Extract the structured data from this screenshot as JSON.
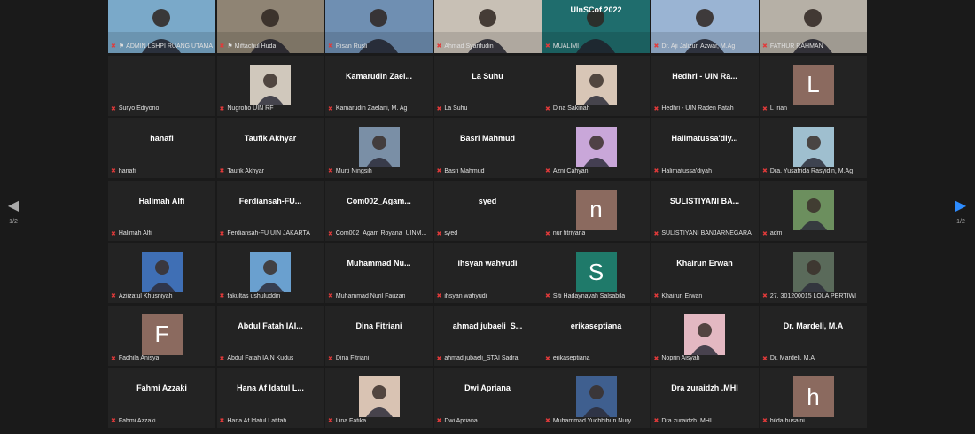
{
  "pager": {
    "indicator": "1/2"
  },
  "colors": {
    "video_bg": "#232323",
    "muted_mic": "#e23a3a",
    "active_border": "#e8d44d",
    "next_arrow": "#2d8cff"
  },
  "participants": [
    {
      "label": "ADMIN LSHPI RUANG UTAMA",
      "kind": "video",
      "bg": "#7aa9c9",
      "pinned": true,
      "active": true
    },
    {
      "label": "Miftachul Huda",
      "kind": "video",
      "bg": "#8f8474",
      "pinned": true
    },
    {
      "label": "Risan Rusli",
      "kind": "video",
      "bg": "#6f8fb2"
    },
    {
      "label": "Ahmad Syarifudin",
      "kind": "video",
      "bg": "#c8c0b5"
    },
    {
      "label": "MUALIMI",
      "kind": "video",
      "bg": "#1f6d6d",
      "banner": "UInSCof 2022"
    },
    {
      "label": "Dr. Aji Jalizun Azwar, M.Ag",
      "kind": "video",
      "bg": "#9ab4d3"
    },
    {
      "label": "FATHUR RAHMAN",
      "kind": "video",
      "bg": "#b6b0a6"
    },
    {
      "label": "Suryo Ediyono",
      "kind": "blank"
    },
    {
      "label": "Nugroho UIN RF",
      "kind": "photo",
      "bg": "#d0c8bc"
    },
    {
      "label": "Kamarudin Zaelani, M. Ag",
      "kind": "name",
      "name": "Kamarudin Zael..."
    },
    {
      "label": "La Suhu",
      "kind": "name",
      "name": "La Suhu"
    },
    {
      "label": "Dina Sakinah",
      "kind": "photo",
      "bg": "#d8c6b6"
    },
    {
      "label": "Hedhri - UIN Raden Fatah",
      "kind": "name",
      "name": "Hedhri - UIN Ra..."
    },
    {
      "label": "L Irian",
      "kind": "letter",
      "letter": "L",
      "color": "#8b6a5f"
    },
    {
      "label": "hanafi",
      "kind": "name",
      "name": "hanafi"
    },
    {
      "label": "Taufik Akhyar",
      "kind": "name",
      "name": "Taufik Akhyar"
    },
    {
      "label": "Murti Ningsih",
      "kind": "photo",
      "bg": "#7a8fa6"
    },
    {
      "label": "Basri Mahmud",
      "kind": "name",
      "name": "Basri Mahmud"
    },
    {
      "label": "Azni Cahyani",
      "kind": "photo",
      "bg": "#c9a7d9"
    },
    {
      "label": "Halimatussa'diyah",
      "kind": "name",
      "name": "Halimatussa'diy..."
    },
    {
      "label": "Dra. Yusafrida Rasyidin, M.Ag",
      "kind": "photo",
      "bg": "#9fbfcf"
    },
    {
      "label": "Halimah Alfi",
      "kind": "name",
      "name": "Halimah Alfi"
    },
    {
      "label": "Ferdiansah-FU UIN JAKARTA",
      "kind": "name",
      "name": "Ferdiansah-FU..."
    },
    {
      "label": "Com002_Agam Royana_UINM...",
      "kind": "name",
      "name": "Com002_Agam..."
    },
    {
      "label": "syed",
      "kind": "name",
      "name": "syed"
    },
    {
      "label": "nur fitriyana",
      "kind": "letter",
      "letter": "n",
      "color": "#8b6a5f"
    },
    {
      "label": "SULISTIYANI BANJARNEGARA",
      "kind": "name",
      "name": "SULISTIYANI BA..."
    },
    {
      "label": "adm",
      "kind": "photo",
      "bg": "#6c8f5e"
    },
    {
      "label": "Aziizatul Khusniyah",
      "kind": "photo",
      "bg": "#3f6fb5"
    },
    {
      "label": "fakultas ushuluddin",
      "kind": "photo",
      "bg": "#6aa0cf"
    },
    {
      "label": "Muhammad Nuril Fauzan",
      "kind": "name",
      "name": "Muhammad Nu..."
    },
    {
      "label": "ihsyan wahyudi",
      "kind": "name",
      "name": "ihsyan wahyudi"
    },
    {
      "label": "Siti Hadaynayah Salsabila",
      "kind": "letter",
      "letter": "S",
      "color": "#1f7a6a"
    },
    {
      "label": "Khairun Erwan",
      "kind": "name",
      "name": "Khairun Erwan"
    },
    {
      "label": "27. 301200015 LOLA PERTIWI",
      "kind": "photo",
      "bg": "#5a6a5a"
    },
    {
      "label": "Fadhila Anisya",
      "kind": "letter",
      "letter": "F",
      "color": "#8b6a5f"
    },
    {
      "label": "Abdul Fatah IAIN Kudus",
      "kind": "name",
      "name": "Abdul Fatah IAI..."
    },
    {
      "label": "Dina Fitriani",
      "kind": "name",
      "name": "Dina Fitriani"
    },
    {
      "label": "ahmad jubaeli_STAI Sadra",
      "kind": "name",
      "name": "ahmad jubaeli_S..."
    },
    {
      "label": "erikaseptiana",
      "kind": "name",
      "name": "erikaseptiana"
    },
    {
      "label": "Noprin Aisyah",
      "kind": "photo",
      "bg": "#e3b8c2"
    },
    {
      "label": "Dr. Mardeli, M.A",
      "kind": "name",
      "name": "Dr. Mardeli, M.A"
    },
    {
      "label": "Fahmi Azzaki",
      "kind": "name",
      "name": "Fahmi Azzaki"
    },
    {
      "label": "Hana Af Idatul Latifah",
      "kind": "name",
      "name": "Hana Af Idatul L..."
    },
    {
      "label": "Lina Fatika",
      "kind": "photo",
      "bg": "#d9c3b3"
    },
    {
      "label": "Dwi Apriana",
      "kind": "name",
      "name": "Dwi Apriana"
    },
    {
      "label": "Muhammad Yuchbibun Nury",
      "kind": "photo",
      "bg": "#3f5f8f"
    },
    {
      "label": "Dra zuraidzh .MHI",
      "kind": "name",
      "name": "Dra zuraidzh .MHI"
    },
    {
      "label": "hilda husaini",
      "kind": "letter",
      "letter": "h",
      "color": "#8b6a5f"
    }
  ]
}
